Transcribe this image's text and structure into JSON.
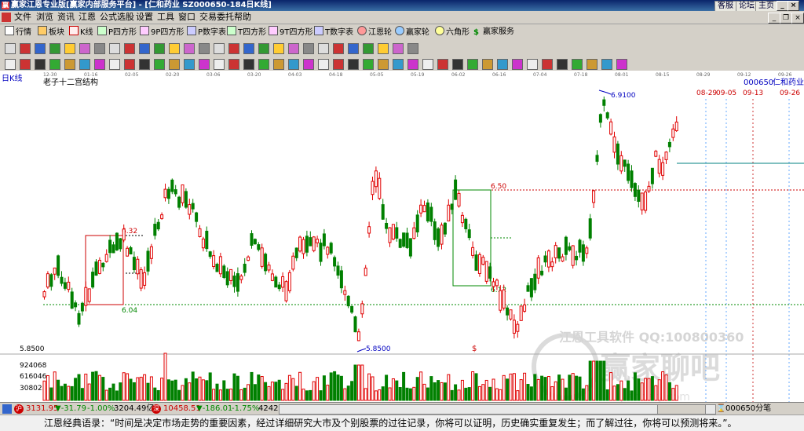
{
  "window": {
    "title": "赢家江恩专业版[赢家内部服务平台] - [仁和药业  SZ000650-184日K线]",
    "links": [
      "客服",
      "论坛",
      "主页"
    ],
    "icon_glyph": "赢"
  },
  "menu": [
    "文件",
    "浏览",
    "资讯",
    "江恩",
    "公式选股",
    "设置",
    "工具",
    "窗口",
    "交易委托",
    "帮助"
  ],
  "toolbar1": [
    "行情",
    "板块",
    "K线",
    "P四方形",
    "9P四方形",
    "P数字表",
    "T四方形",
    "9T四方形",
    "T数字表",
    "江恩轮",
    "赢家轮",
    "六角形",
    "赢家服务"
  ],
  "chart": {
    "period_label": "日K线",
    "structure_label": "老子十二宫结构",
    "stock_code": "000650",
    "stock_name": "仁和药业",
    "date_axis": [
      "12-30",
      "01-16",
      "02-05",
      "02-20",
      "03-06",
      "03-20",
      "04-03",
      "04-18",
      "05-05",
      "05-19",
      "06-02",
      "06-16",
      "07-04",
      "07-18",
      "08-01",
      "08-15",
      "08-29",
      "09-12",
      "09-26"
    ],
    "future_dates": [
      "08-29",
      "09-05",
      "09-13",
      "09-26"
    ],
    "price_labels": {
      "high": "6.9100",
      "low": "5.8500",
      "box1_top": "6.32",
      "box1_bottom": "6.04",
      "box2_top": "6.50",
      "box2_bottom": "6.12",
      "left_mark": "5.8500"
    },
    "dollar_mark": "$",
    "volume_ticks": [
      "924068",
      "616046",
      "308023"
    ],
    "watermark_1": "江恩工具软件  QQ:100800360",
    "watermark_2": "赢家聊吧",
    "watermark_3": "jiaoba.yicom",
    "colors": {
      "up": "#e00000",
      "down": "#008000",
      "accent": "#0000c0"
    }
  },
  "statusbar": {
    "sh_index": "3131.95",
    "sh_change": "▼-31.79",
    "sh_pct": "-1.00%",
    "sh_amount": "3204.49亿",
    "sz_index": "10458.51",
    "sz_change": "▼-186.01",
    "sz_pct": "-1.75%",
    "sz_amount": "4242",
    "right_label": "000650分笔"
  },
  "quote": "江恩经典语录：“时间是决定市场走势的重要因素，经过详细研究大市及个别股票的过往记录，你将可以证明，历史确实重复发生；而了解过往，你将可以预测将来。”。"
}
